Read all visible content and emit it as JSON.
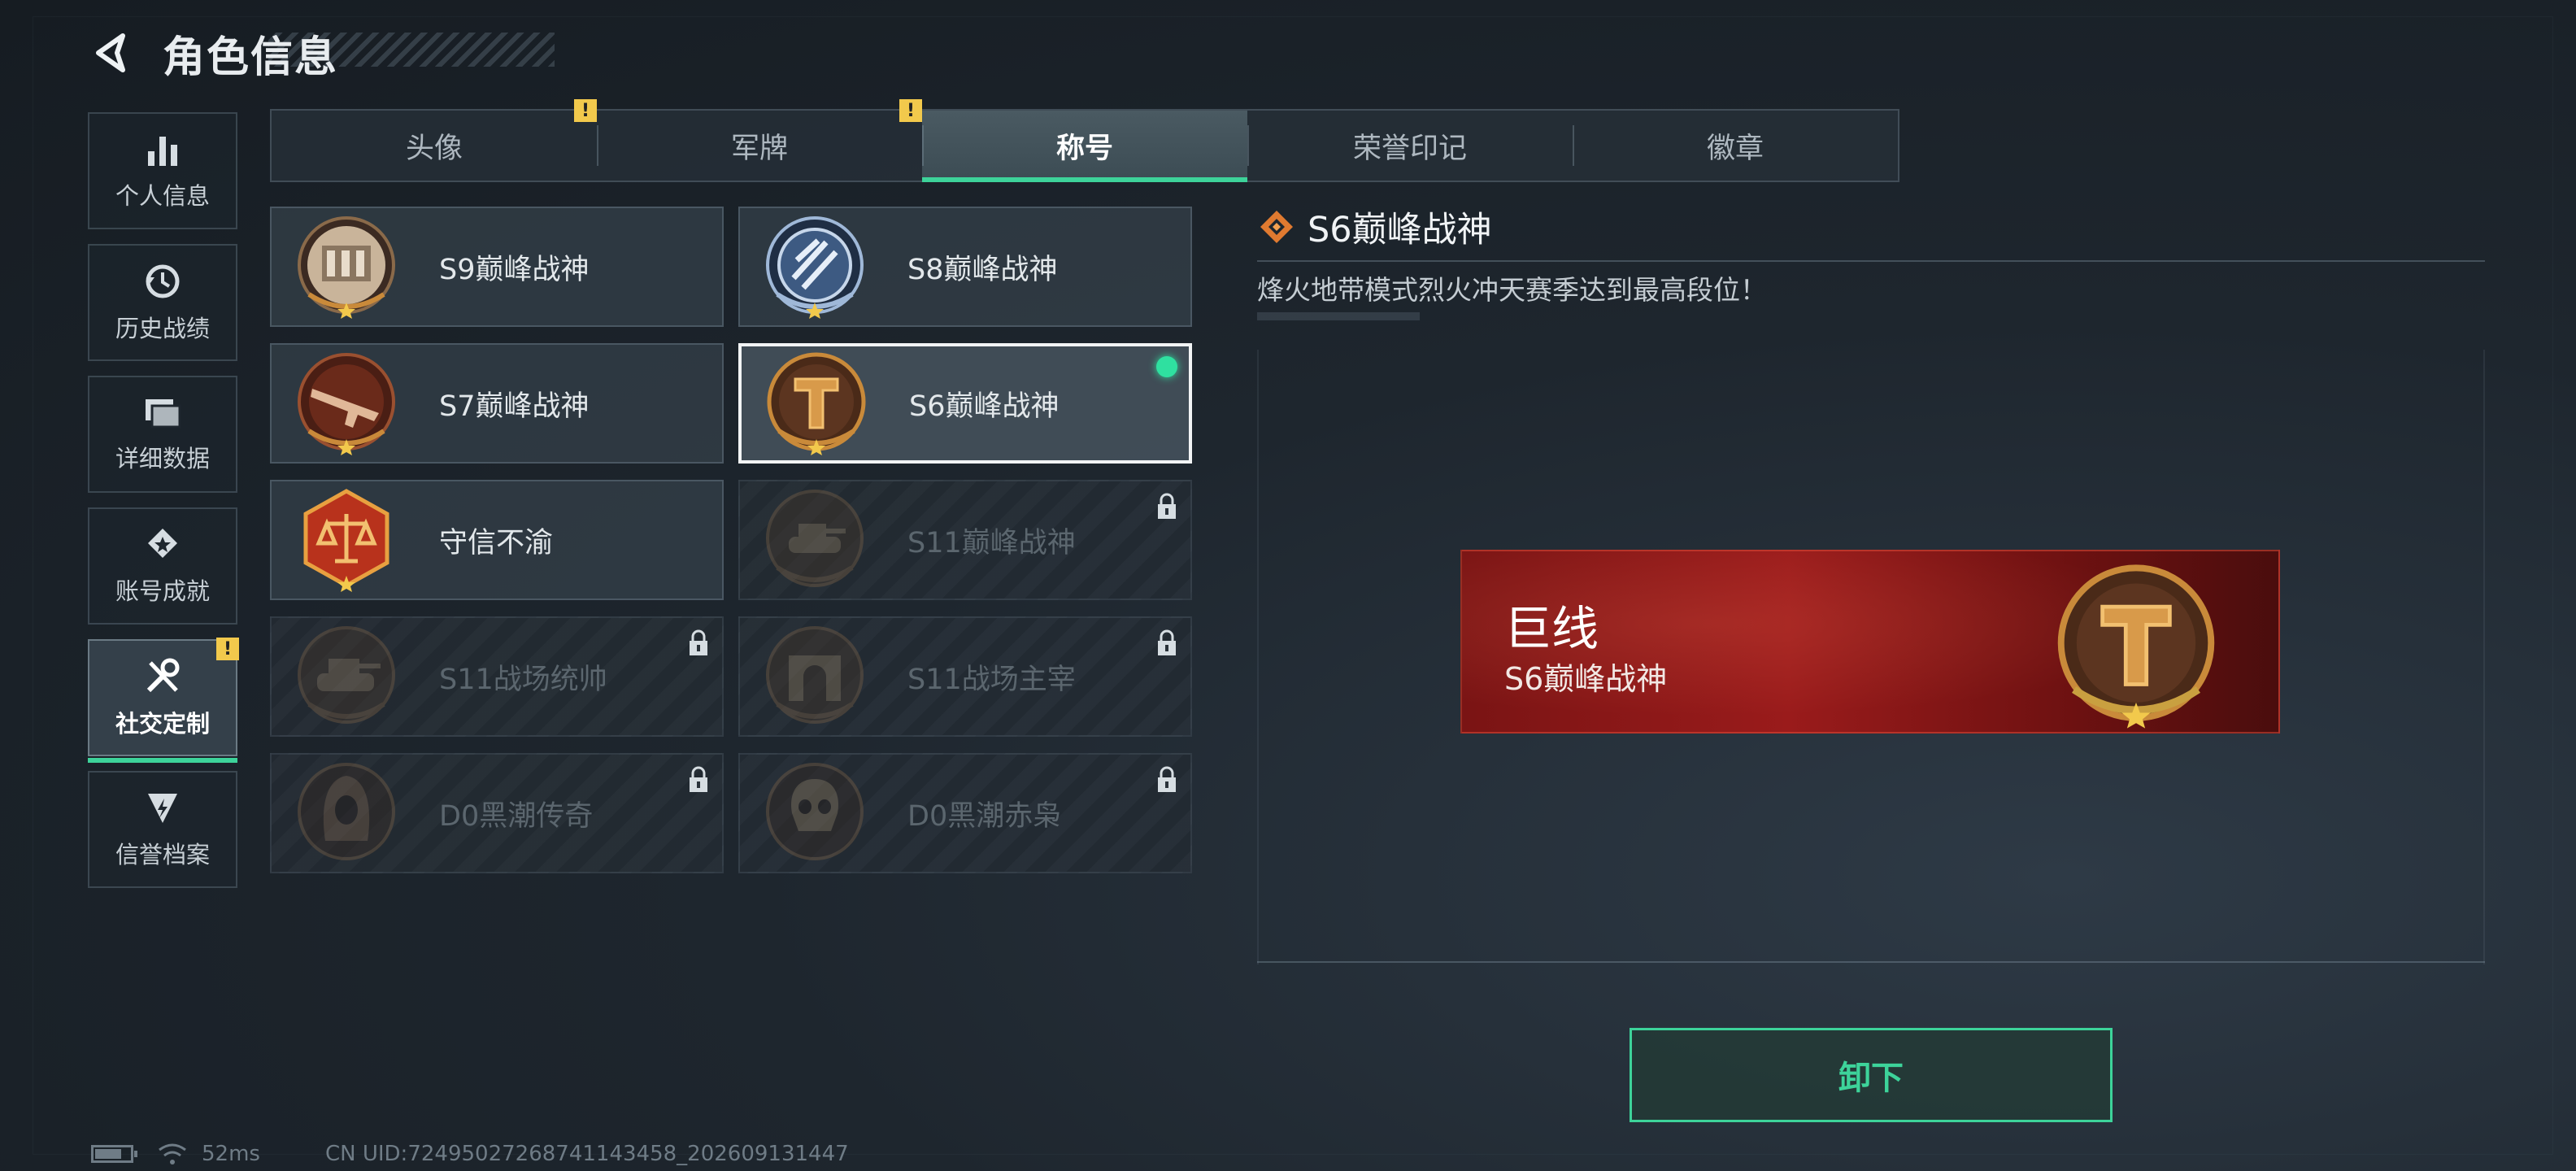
{
  "header": {
    "title": "角色信息"
  },
  "sidebar": {
    "items": [
      {
        "label": "个人信息",
        "icon": "bar-chart-icon",
        "active": false,
        "warn": false
      },
      {
        "label": "历史战绩",
        "icon": "history-icon",
        "active": false,
        "warn": false
      },
      {
        "label": "详细数据",
        "icon": "folders-icon",
        "active": false,
        "warn": false
      },
      {
        "label": "账号成就",
        "icon": "achievement-icon",
        "active": false,
        "warn": false
      },
      {
        "label": "社交定制",
        "icon": "tools-icon",
        "active": true,
        "warn": true
      },
      {
        "label": "信誉档案",
        "icon": "credit-icon",
        "active": false,
        "warn": false
      }
    ]
  },
  "tabs": [
    {
      "label": "头像",
      "active": false,
      "warn": true
    },
    {
      "label": "军牌",
      "active": false,
      "warn": true
    },
    {
      "label": "称号",
      "active": true,
      "warn": false
    },
    {
      "label": "荣誉印记",
      "active": false,
      "warn": false
    },
    {
      "label": "徽章",
      "active": false,
      "warn": false
    }
  ],
  "titles": [
    {
      "name": "S9巅峰战神",
      "medal": "fortress-medal-icon",
      "locked": false,
      "selected": false
    },
    {
      "name": "S8巅峰战神",
      "medal": "emblem-blue-medal-icon",
      "locked": false,
      "selected": false
    },
    {
      "name": "S7巅峰战神",
      "medal": "rifle-medal-icon",
      "locked": false,
      "selected": false
    },
    {
      "name": "S6巅峰战神",
      "medal": "shield-t-medal-icon",
      "locked": false,
      "selected": true
    },
    {
      "name": "守信不渝",
      "medal": "scales-medal-icon",
      "locked": false,
      "selected": false
    },
    {
      "name": "S11巅峰战神",
      "medal": "tank-medal-icon",
      "locked": true,
      "selected": false
    },
    {
      "name": "S11战场统帅",
      "medal": "tank-medal-icon",
      "locked": true,
      "selected": false
    },
    {
      "name": "S11战场主宰",
      "medal": "arch-medal-icon",
      "locked": true,
      "selected": false
    },
    {
      "name": "D0黑潮传奇",
      "medal": "hooded-medal-icon",
      "locked": true,
      "selected": false
    },
    {
      "name": "D0黑潮赤枭",
      "medal": "skull-medal-icon",
      "locked": true,
      "selected": false
    }
  ],
  "detail": {
    "title": "S6巅峰战神",
    "description": "烽火地带模式烈火冲天赛季达到最高段位！",
    "banner": {
      "player_name": "巨线",
      "title": "S6巅峰战神"
    },
    "unequip_label": "卸下"
  },
  "status": {
    "ping": "52ms",
    "uid": "CN UID:7249502726874114345­8_202609131447"
  },
  "colors": {
    "accent": "#3dd39a",
    "warn": "#f2c94c",
    "banner": "#8a1818",
    "medal_gold": "#c98a3a"
  }
}
